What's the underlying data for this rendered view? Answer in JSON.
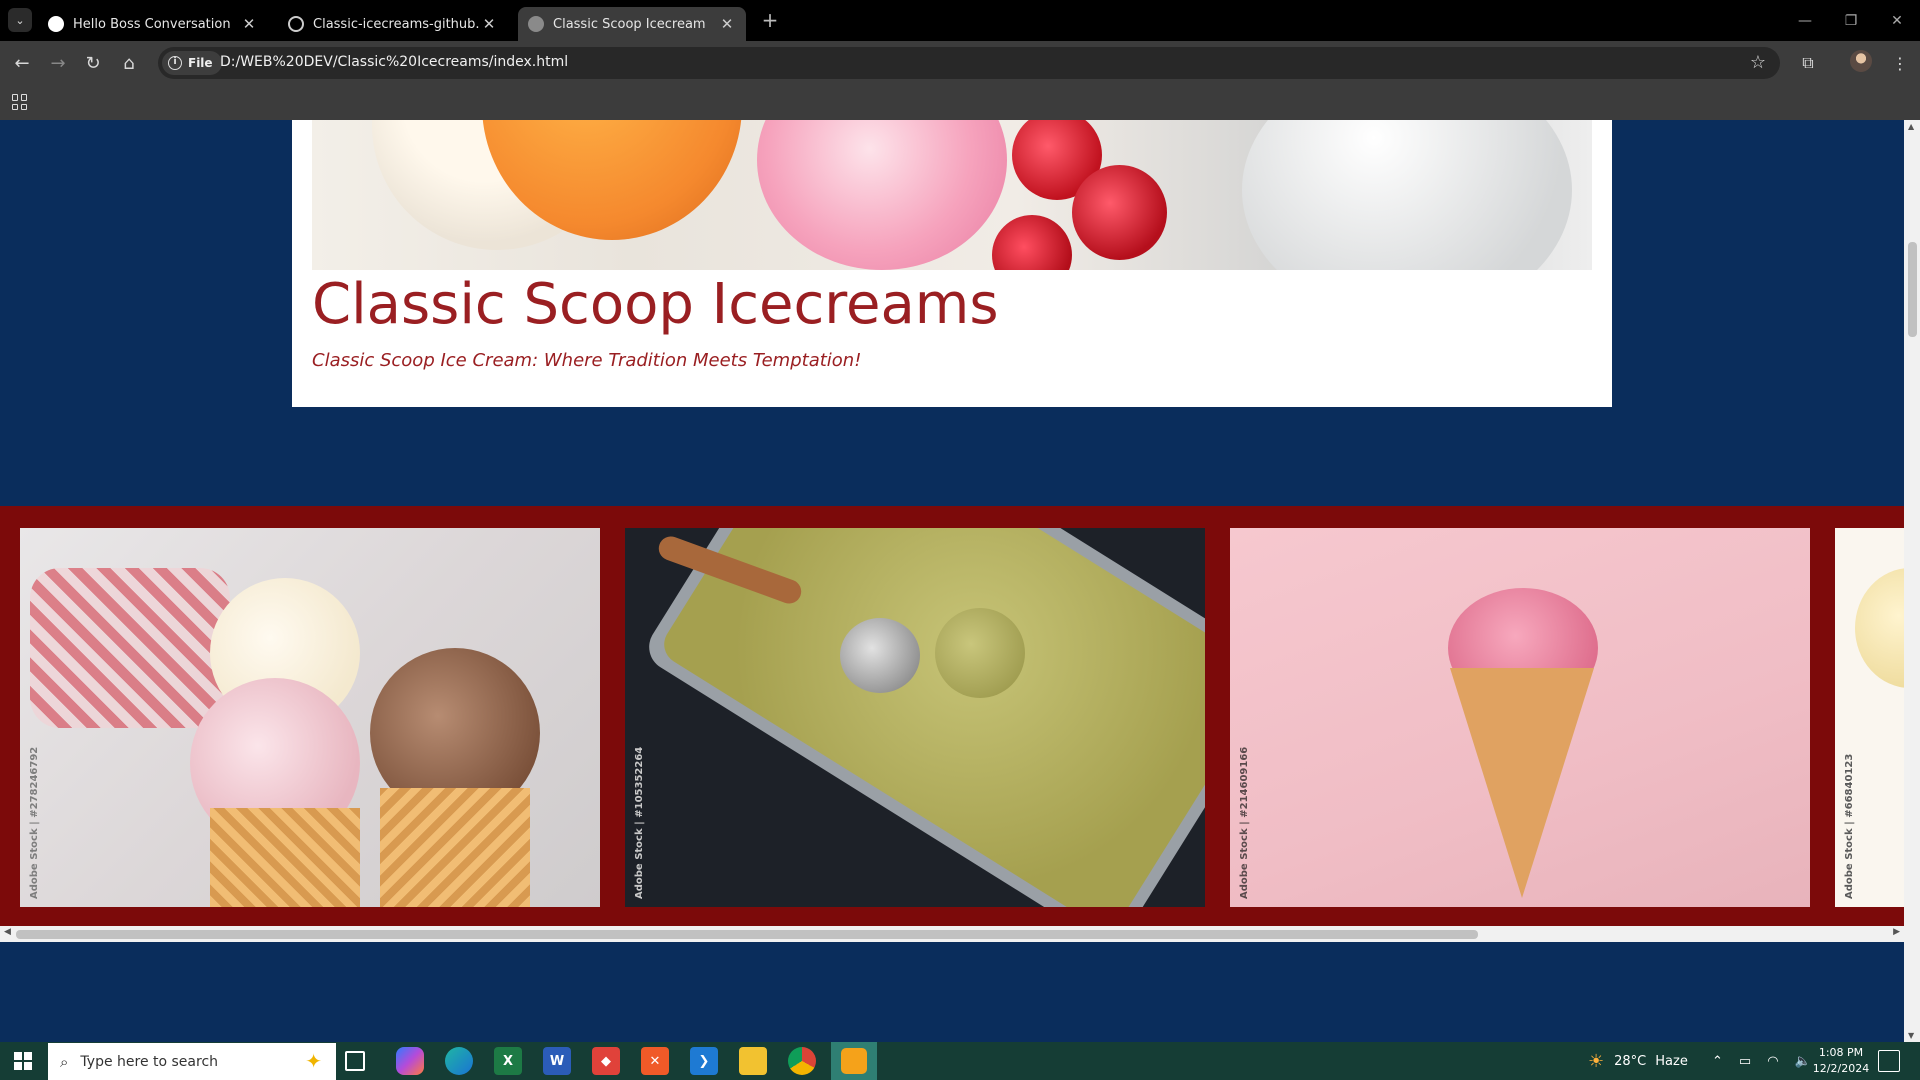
{
  "browser": {
    "tabs": [
      {
        "title": "Hello Boss Conversation",
        "active": false
      },
      {
        "title": "Classic-icecreams-github.io/README",
        "active": false
      },
      {
        "title": "Classic Scoop Icecream",
        "active": true
      }
    ],
    "address": {
      "chip_label": "File",
      "url": "D:/WEB%20DEV/Classic%20Icecreams/index.html"
    }
  },
  "page": {
    "site_title": "Classic Scoop Icecreams",
    "tagline": "Classic Scoop Ice Cream: Where Tradition Meets Temptation!",
    "gallery": [
      {
        "credit": "Adobe Stock | #278246792"
      },
      {
        "credit": "Adobe Stock | #105352264"
      },
      {
        "credit": "Adobe Stock | #214609166"
      },
      {
        "credit": "Adobe Stock | #66840123"
      }
    ],
    "colors": {
      "page_bg": "#0a2d5c",
      "accent": "#9a1f22",
      "gallery_bg": "#7c0a0a"
    }
  },
  "taskbar": {
    "search_placeholder": "Type here to search",
    "weather": {
      "temp": "28°C",
      "condition": "Haze"
    },
    "clock": {
      "time": "1:08 PM",
      "date": "12/2/2024"
    }
  }
}
